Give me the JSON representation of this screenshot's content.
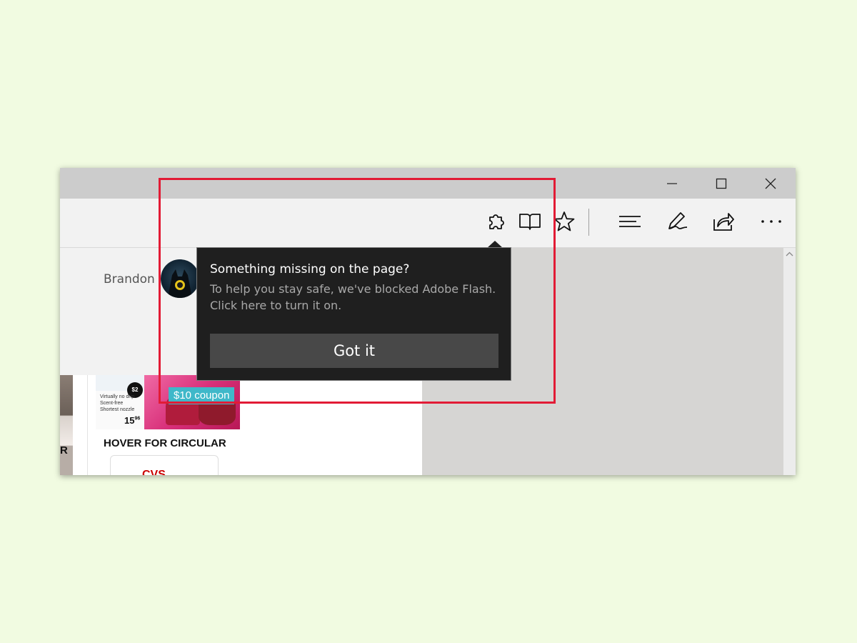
{
  "profile": {
    "username": "Brandon"
  },
  "page_content": {
    "coupon_badge": "$10 coupon",
    "ad_caption": "HOVER FOR CIRCULAR",
    "ad_left_fragment": "R",
    "product_lines": [
      "Virtually no drip",
      "Scent-free",
      "Shortest nozzle"
    ],
    "product_price": "15",
    "product_price_cents": "96",
    "brand_logo": "CVS"
  },
  "flash_flyout": {
    "title": "Something missing on the page?",
    "body": "To help you stay safe, we've blocked Adobe Flash. Click here to turn it on.",
    "button_label": "Got it"
  },
  "colors": {
    "highlight": "#e21b35",
    "flyout_bg": "#1f1f1f",
    "button_bg": "#484848",
    "coupon_bg": "#3fb8c9",
    "page_bg": "#f1fbe1"
  },
  "icons": {
    "titlebar": [
      "minimize-icon",
      "maximize-icon",
      "close-icon"
    ],
    "toolbar": [
      "puzzle-icon",
      "reading-view-icon",
      "favorite-star-icon",
      "hub-icon",
      "web-note-icon",
      "share-icon",
      "more-icon"
    ]
  }
}
